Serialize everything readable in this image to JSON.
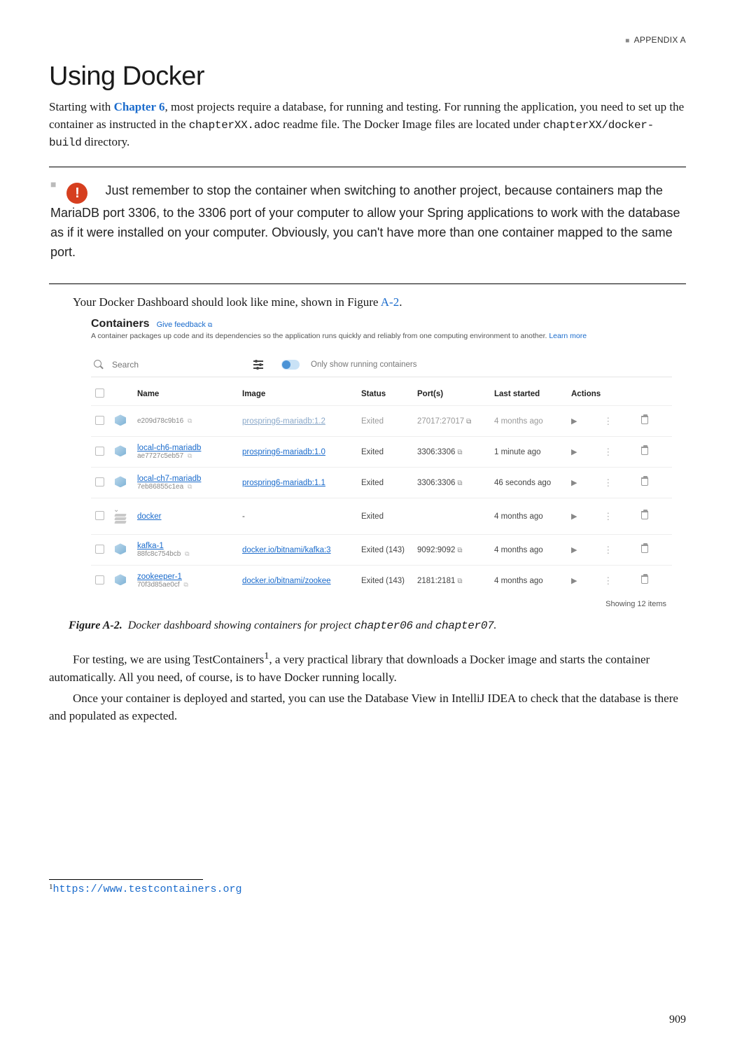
{
  "running_head": "APPENDIX A",
  "section_title": "Using Docker",
  "intro_html": "Starting with <b class='chap-link' data-name='chapter-link' data-interactable='true'>Chapter 6</b>, most projects require a database, for running and testing. For running the application, you need to set up the container as instructed in the <code>chapterXX.adoc</code> readme file. The Docker Image files are located under <code>chapterXX/docker-build</code> directory.",
  "callout": "Just remember to stop the container when switching to another project, because containers map the MariaDB port 3306, to the 3306 port of your computer to allow your Spring applications to work with the database as if it were installed on your computer. Obviously, you can't have more than one container mapped to the same port.",
  "pre_figure": "Your Docker Dashboard should look like mine, shown in Figure ",
  "figure_ref": "A-2",
  "post_figure": ".",
  "dashboard": {
    "title": "Containers",
    "feedback": "Give feedback",
    "subtitle": "A container packages up code and its dependencies so the application runs quickly and reliably from one computing environment to another.",
    "learn_more": "Learn more",
    "search_placeholder": "Search",
    "toggle_label": "Only show running containers",
    "headers": {
      "name": "Name",
      "image": "Image",
      "status": "Status",
      "ports": "Port(s)",
      "last": "Last started",
      "actions": "Actions"
    },
    "rows": [
      {
        "icon": "cube",
        "faded": true,
        "name": "",
        "id": "e209d78c9b16",
        "image": "prospring6-mariadb:1.2",
        "image_link": true,
        "status": "Exited",
        "ports": "27017:27017",
        "launch": true,
        "last": "4 months ago"
      },
      {
        "icon": "cube",
        "name": "local-ch6-mariadb",
        "name_link": true,
        "id": "ae7727c5eb57",
        "image": "prospring6-mariadb:1.0",
        "image_link": true,
        "status": "Exited",
        "ports": "3306:3306",
        "launch": true,
        "last": "1 minute ago"
      },
      {
        "icon": "cube",
        "name": "local-ch7-mariadb",
        "name_link": true,
        "id": "7eb86855c1ea",
        "image": "prospring6-mariadb:1.1",
        "image_link": true,
        "status": "Exited",
        "ports": "3306:3306",
        "launch": true,
        "last": "46 seconds ago"
      },
      {
        "icon": "stack",
        "chev": true,
        "name": "docker",
        "name_link": true,
        "id": "",
        "image": "-",
        "status": "Exited",
        "ports": "",
        "last": "4 months ago"
      },
      {
        "icon": "cube",
        "name": "kafka-1",
        "name_link": true,
        "id": "88fc8c754bcb",
        "image": "docker.io/bitnami/kafka:3",
        "image_link": true,
        "status": "Exited (143)",
        "ports": "9092:9092",
        "launch": true,
        "last": "4 months ago"
      },
      {
        "icon": "cube",
        "name": "zookeeper-1",
        "name_link": true,
        "id": "70f3d85ae0cf",
        "image": "docker.io/bitnami/zookee",
        "image_link": true,
        "status": "Exited (143)",
        "ports": "2181:2181",
        "launch": true,
        "last": "4 months ago"
      }
    ],
    "showing": "Showing 12 items"
  },
  "caption_label": "Figure A-2.",
  "caption_body_html": "Docker dashboard showing containers for project <code>chapter06</code> and <code>chapter07</code>.",
  "after1_html": "For testing, we are using TestContainers<sup>1</sup>, a very practical library that downloads a Docker image and starts the container automatically. All you need, of course, is to have Docker running locally.",
  "after2": "Once your container is deployed and started, you can use the Database View in IntelliJ IDEA to check that the database is there and populated as expected.",
  "footnote_num": "1",
  "footnote_url": "https://www.testcontainers.org",
  "page_number": "909"
}
